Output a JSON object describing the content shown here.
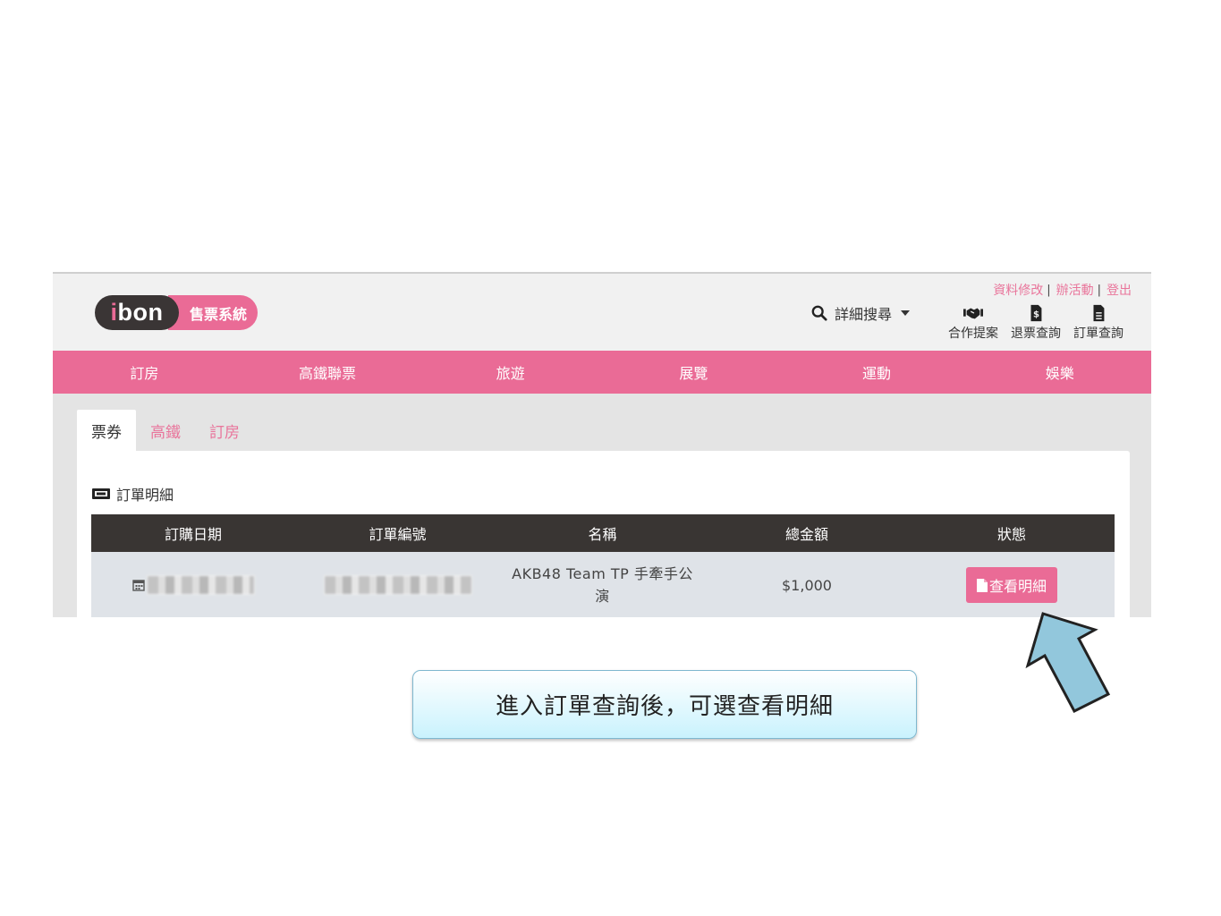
{
  "logo": {
    "main_i": "i",
    "main_rest": "bon",
    "sub": "售票系統"
  },
  "header": {
    "search_label": "詳細搜尋",
    "user_links": [
      "資料修改",
      "辦活動",
      "登出"
    ],
    "quick_links": [
      "合作提案",
      "退票查詢",
      "訂單查詢"
    ]
  },
  "nav": [
    "訂房",
    "高鐵聯票",
    "旅遊",
    "展覽",
    "運動",
    "娛樂"
  ],
  "tabs": [
    "票券",
    "高鐵",
    "訂房"
  ],
  "card": {
    "title": "訂單明細"
  },
  "table": {
    "headers": [
      "訂購日期",
      "訂單編號",
      "名稱",
      "總金額",
      "狀態"
    ],
    "rows": [
      {
        "name": "AKB48 Team TP 手牽手公演",
        "total": "$1,000",
        "action": "查看明細"
      }
    ]
  },
  "callout": {
    "text": "進入訂單查詢後，可選查看明細"
  },
  "colors": {
    "brand_pink": "#ea6b96",
    "header_dark": "#393533",
    "callout_blue": "#c9f2fd",
    "arrow_blue": "#92c7dc"
  }
}
